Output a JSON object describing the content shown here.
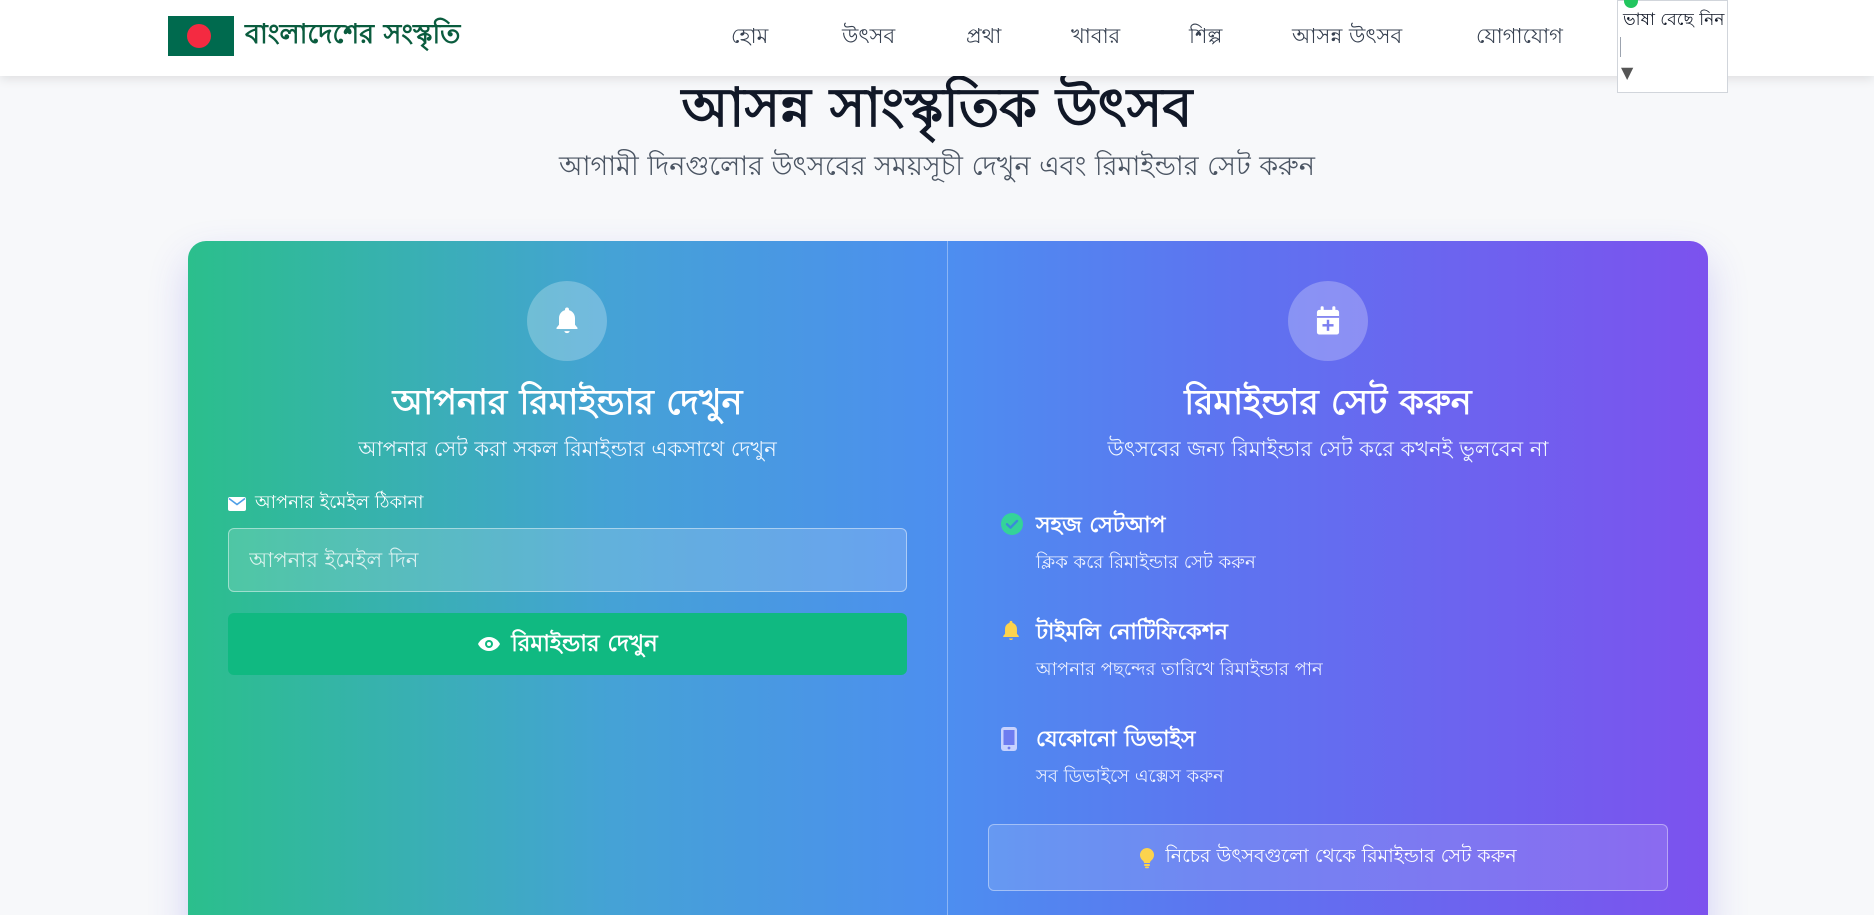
{
  "nav": {
    "brand": "বাংলাদেশের সংস্কৃতি",
    "links": [
      "হোম",
      "উৎসব",
      "প্রথা",
      "খাবার",
      "শিল্প",
      "আসন্ন উৎসব",
      "যোগাযোগ"
    ],
    "language_label": "ভাষা বেছে নিন",
    "language_caret": "▼"
  },
  "hero": {
    "title": "আসন্ন সাংস্কৃতিক উৎসব",
    "subtitle": "আগামী দিনগুলোর উৎসবের সময়সূচী দেখুন এবং রিমাইন্ডার সেট করুন"
  },
  "view_panel": {
    "icon": "bell-icon",
    "title": "আপনার রিমাইন্ডার দেখুন",
    "subtitle": "আপনার সেট করা সকল রিমাইন্ডার একসাথে দেখুন",
    "email_label": "আপনার ইমেইল ঠিকানা",
    "email_placeholder": "আপনার ইমেইল দিন",
    "button_label": "রিমাইন্ডার দেখুন"
  },
  "set_panel": {
    "icon": "calendar-plus-icon",
    "title": "রিমাইন্ডার সেট করুন",
    "subtitle": "উৎসবের জন্য রিমাইন্ডার সেট করে কখনই ভুলবেন না",
    "features": [
      {
        "icon": "check-circle-icon",
        "title": "সহজ সেটআপ",
        "desc": "ক্লিক করে রিমাইন্ডার সেট করুন"
      },
      {
        "icon": "bell-icon",
        "title": "টাইমলি নোটিফিকেশন",
        "desc": "আপনার পছন্দের তারিখে রিমাইন্ডার পান"
      },
      {
        "icon": "mobile-icon",
        "title": "যেকোনো ডিভাইস",
        "desc": "সব ডিভাইসে এক্সেস করুন"
      }
    ],
    "tip": "নিচের উৎসবগুলো থেকে রিমাইন্ডার সেট করুন"
  },
  "colors": {
    "accent_green": "#10b981",
    "brand_green": "#006a4e",
    "flag_red": "#f42a41",
    "gradient_start": "#2bbf8c",
    "gradient_end": "#7c52ee"
  }
}
